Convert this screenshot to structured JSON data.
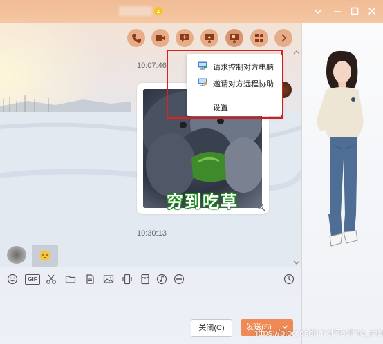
{
  "colors": {
    "accent": "#f08a55",
    "menu_border": "#e02020"
  },
  "titlebar": {
    "icons": [
      "chevron-down-icon",
      "minimize-icon",
      "maximize-icon",
      "close-icon"
    ]
  },
  "toolbar": {
    "buttons": [
      "phone-icon",
      "video-icon",
      "message-plus-icon",
      "screen-share-icon",
      "remote-desktop-icon",
      "apps-icon",
      "more-arrow-icon"
    ]
  },
  "chat": {
    "time1": "10:07:46",
    "time2": "10:30:13",
    "sticker_caption": "穷到吃草"
  },
  "menu": {
    "items": [
      {
        "label": "请求控制对方电脑",
        "icon": "monitor-control-icon"
      },
      {
        "label": "邀请对方远程协助",
        "icon": "monitor-invite-icon"
      },
      {
        "label": "设置",
        "icon": ""
      }
    ]
  },
  "input_toolbar": {
    "icons": [
      "emoji-icon",
      "gif-icon",
      "scissors-icon",
      "folder-icon",
      "doc-icon",
      "image-icon",
      "phone-device-icon",
      "red-packet-icon",
      "music-icon",
      "more-icon",
      "history-icon"
    ],
    "gif_label": "GIF"
  },
  "buttons": {
    "close": "关闭(C)",
    "send": "发送(S)"
  },
  "watermark": "https://blog.csdn.net/Techno_rabbit"
}
